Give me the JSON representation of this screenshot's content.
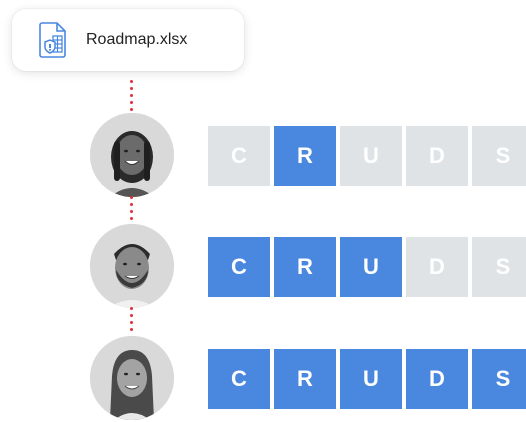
{
  "file": {
    "name": "Roadmap.xlsx",
    "icon": "spreadsheet-lock-icon"
  },
  "colors": {
    "accent": "#4a88e0",
    "inactive": "#dfe3e6",
    "connector": "#e0303a"
  },
  "users": [
    {
      "avatar": "avatar-woman-braids",
      "permissions": [
        {
          "letter": "C",
          "active": false
        },
        {
          "letter": "R",
          "active": true
        },
        {
          "letter": "U",
          "active": false
        },
        {
          "letter": "D",
          "active": false
        },
        {
          "letter": "S",
          "active": false
        }
      ]
    },
    {
      "avatar": "avatar-man-beard",
      "permissions": [
        {
          "letter": "C",
          "active": true
        },
        {
          "letter": "R",
          "active": true
        },
        {
          "letter": "U",
          "active": true
        },
        {
          "letter": "D",
          "active": false
        },
        {
          "letter": "S",
          "active": false
        }
      ]
    },
    {
      "avatar": "avatar-woman-long-hair",
      "permissions": [
        {
          "letter": "C",
          "active": true
        },
        {
          "letter": "R",
          "active": true
        },
        {
          "letter": "U",
          "active": true
        },
        {
          "letter": "D",
          "active": true
        },
        {
          "letter": "S",
          "active": true
        }
      ]
    }
  ]
}
